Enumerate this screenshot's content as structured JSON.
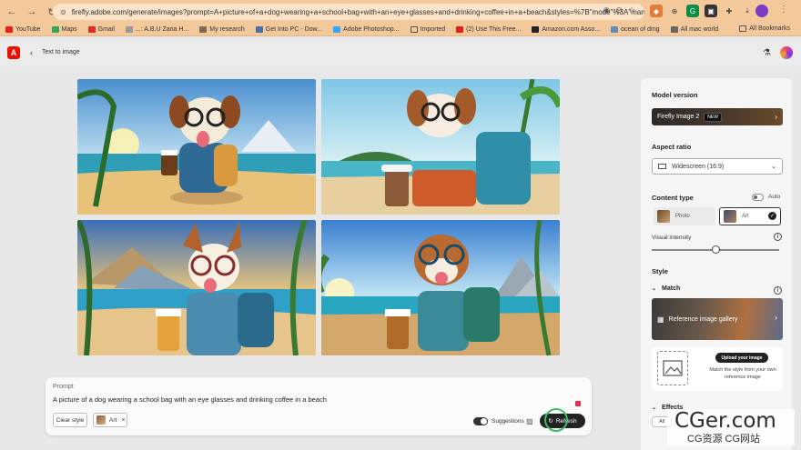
{
  "browser": {
    "url": "firefly.adobe.com/generate/images?prompt=A+picture+of+a+dog+wearing+a+school+bag+with+an+eye+glasses+and+drinking+coffee+in+a+beach&styles=%7B\"mode\"%3A\"manua...",
    "bookmarks": [
      "YouTube",
      "Maps",
      "Gmail",
      "...: A.B.U Zaria H...",
      "My research",
      "Get Into PC - Dow...",
      "Adobe Photoshop...",
      "Imported",
      "(2) Use This Free...",
      "Amazon.com Asso...",
      "ocean of dmg",
      "All mac world"
    ],
    "all_bookmarks": "All Bookmarks"
  },
  "header": {
    "logo": "A",
    "title": "Text to image"
  },
  "prompt": {
    "label": "Prompt",
    "text": "A picture of a dog wearing a school bag with an eye glasses and drinking coffee in a beach",
    "clear_style": "Clear style",
    "style_chip": "Art",
    "suggestions": "Suggestions",
    "refresh": "Refresh"
  },
  "panel": {
    "model_version": "Model version",
    "model_name": "Firefly Image 2",
    "model_badge": "NEW",
    "aspect_ratio": "Aspect ratio",
    "aspect_value": "Widescreen (16:9)",
    "content_type": "Content type",
    "auto": "Auto",
    "photo": "Photo",
    "art": "Art",
    "visual_intensity": "Visual intensity",
    "visual_intensity_value": 0.5,
    "style": "Style",
    "match": "Match",
    "reference_gallery": "Reference image gallery",
    "upload_button": "Upload your image",
    "upload_desc": "Match the style from your own reference image",
    "effects": "Effects",
    "effects_chip": "All"
  },
  "watermark": {
    "main": "CGer.com",
    "sub": "CG资源 CG网站"
  },
  "colors": {
    "chrome": "#f3c89a",
    "accent_red": "#eb1000",
    "refresh_ring": "#3dbb6a"
  }
}
